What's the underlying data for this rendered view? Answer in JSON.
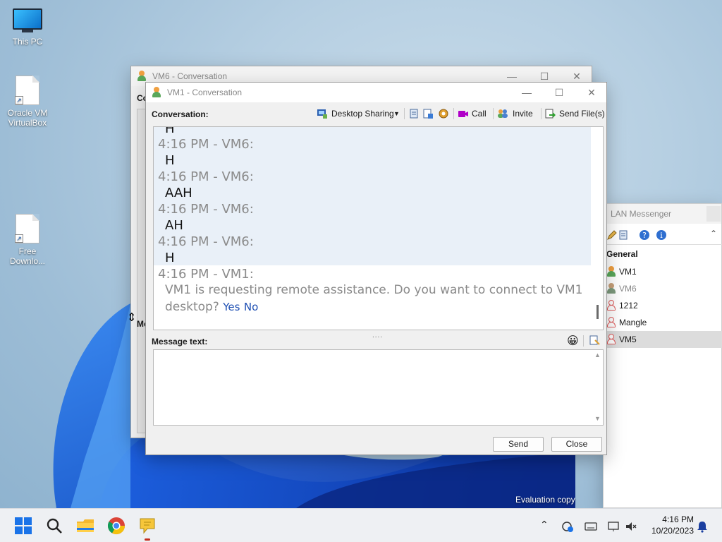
{
  "desktop": {
    "icons": [
      {
        "label": "This PC"
      },
      {
        "label": "Oracle VM VirtualBox"
      },
      {
        "label": "Free Downlo..."
      }
    ],
    "watermark": "Evaluation copy"
  },
  "vm6_window": {
    "title": "VM6 - Conversation",
    "conv_label_partial": "Co",
    "msg_label_partial": "Me"
  },
  "lan_window": {
    "title": "LAN Messenger",
    "group": "General",
    "contacts": [
      {
        "name": "VM1",
        "status": "online"
      },
      {
        "name": "VM6",
        "status": "away"
      },
      {
        "name": "1212",
        "status": "offline"
      },
      {
        "name": "Mangle",
        "status": "offline"
      },
      {
        "name": "VM5",
        "status": "offline",
        "selected": true
      }
    ]
  },
  "vm1_window": {
    "title": "VM1 - Conversation",
    "conversation_label": "Conversation:",
    "toolbar": {
      "desktop_sharing": "Desktop Sharing",
      "call": "Call",
      "invite": "Invite",
      "send_files": "Send File(s)"
    },
    "messages": [
      {
        "header": "4:16 PM - VM6:",
        "body": "H"
      },
      {
        "header": "4:16 PM - VM6:",
        "body": "AAH"
      },
      {
        "header": "4:16 PM - VM6:",
        "body": "AH"
      },
      {
        "header": "4:16 PM - VM6:",
        "body": "H"
      }
    ],
    "partial_top": "H",
    "system_message": {
      "header": "4:16 PM - VM1:",
      "text_line1": "VM1 is requesting remote assistance. Do you want to connect to VM1",
      "text_line2": "desktop?",
      "yes": "Yes",
      "no": "No"
    },
    "message_text_label": "Message text:",
    "message_value": "",
    "send_button": "Send",
    "close_button": "Close"
  },
  "taskbar": {
    "time": "4:16 PM",
    "date": "10/20/2023"
  }
}
